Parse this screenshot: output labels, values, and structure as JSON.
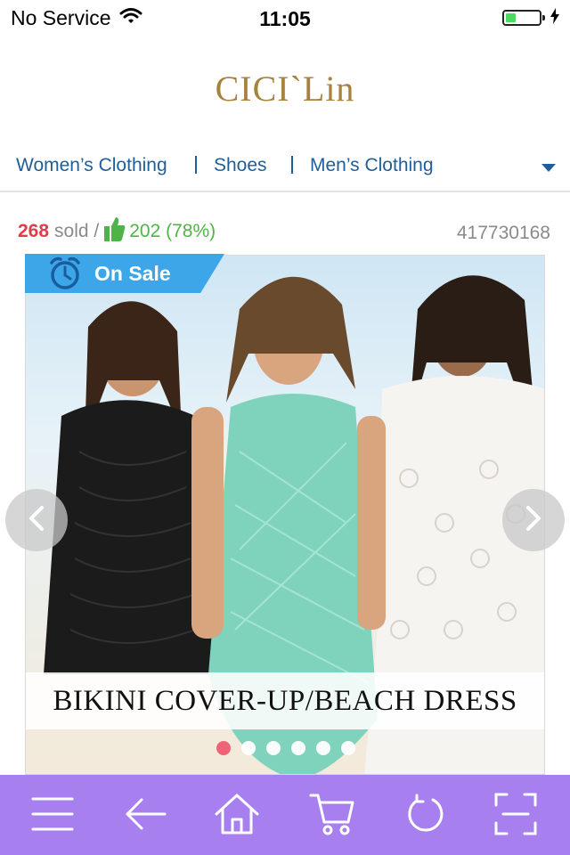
{
  "status_bar": {
    "carrier": "No Service",
    "time": "11:05",
    "battery_level": 0.3,
    "icons": [
      "wifi-icon",
      "battery-icon",
      "charging-bolt-icon"
    ]
  },
  "header": {
    "logo_text": "CICI`Lin"
  },
  "category_nav": {
    "items": [
      {
        "label": "Women’s Clothing"
      },
      {
        "label": "Shoes"
      },
      {
        "label": "Men’s Clothing"
      }
    ],
    "more_icon": "chevron-down-icon"
  },
  "product": {
    "sold_count": "268",
    "sold_label": "sold /",
    "likes": "202 (78%)",
    "product_id": "417730168",
    "sale_badge": "On Sale",
    "banner_text": "BIKINI COVER-UP/BEACH DRESS",
    "carousel": {
      "slide_count": 6,
      "active_slide": 1
    }
  },
  "toolbar": {
    "items": [
      "menu-icon",
      "back-arrow-icon",
      "home-icon",
      "cart-icon",
      "refresh-icon",
      "scan-icon"
    ]
  },
  "colors": {
    "nav_link": "#1f5e99",
    "sold_count": "#e03c4a",
    "likes": "#4eb447",
    "logo": "#a6823d",
    "sale_ribbon": "#3da6e8",
    "toolbar_bg": "#a77fee",
    "active_dot": "#ee6477",
    "battery": "#4cd964"
  }
}
